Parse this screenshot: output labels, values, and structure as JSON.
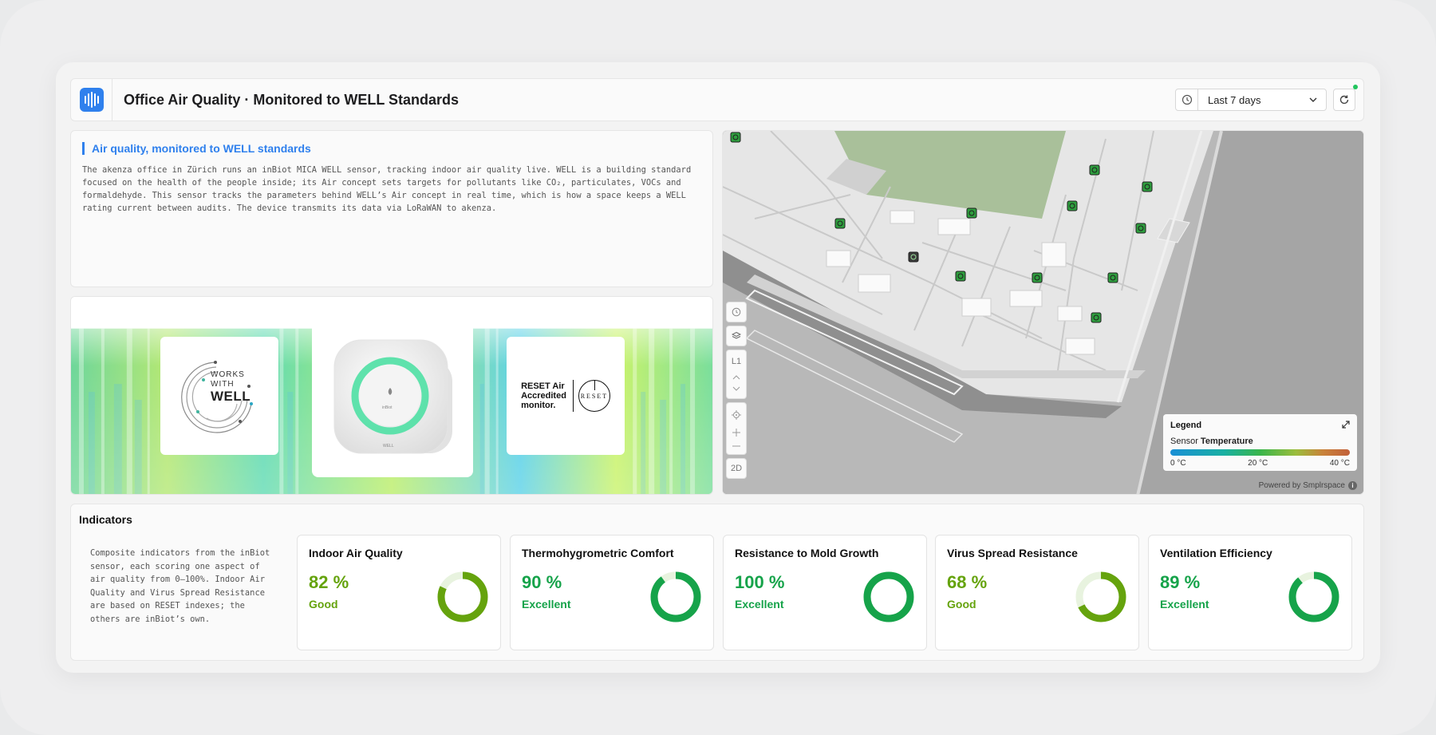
{
  "header": {
    "title": "Office Air Quality · Monitored to WELL Standards",
    "time_range": "Last 7 days"
  },
  "description": {
    "title": "Air quality, monitored to WELL standards",
    "text": "The akenza office in Zürich runs an inBiot MICA WELL sensor, tracking indoor air quality live. WELL is a building standard focused on the health of the people inside; its Air concept sets targets for pollutants like CO₂, particulates, VOCs and formaldehyde. This sensor tracks the parameters behind WELL’s Air concept in real time, which is how a space keeps a WELL rating current between audits. The device transmits its data via LoRaWAN to akenza."
  },
  "images": {
    "well_badge": [
      "WORKS",
      "WITH",
      "WELL"
    ],
    "device_brand": "inBiot",
    "device_label": "WELL",
    "reset_text": [
      "RESET Air",
      "Accredited",
      "monitor."
    ],
    "reset_mark": "RESET"
  },
  "map": {
    "tools": {
      "level": "L1",
      "view_mode": "2D"
    },
    "legend": {
      "title": "Legend",
      "sensor_prefix": "Sensor",
      "sensor_metric": "Temperature",
      "ticks": [
        "0 °C",
        "20 °C",
        "40 °C"
      ],
      "gradient_colors": [
        "#1a8fd6",
        "#19b0a2",
        "#39b54a",
        "#9bbd3c",
        "#c9823a",
        "#c2603a"
      ]
    },
    "powered_by": "Powered by Smplrspace",
    "sensor_marker_color": "#2e9e3e"
  },
  "indicators": {
    "title": "Indicators",
    "text": "Composite indicators from the inBiot sensor, each scoring one aspect of air quality from 0–100%. Indoor Air Quality and Virus Spread Resistance are based on RESET indexes; the others are inBiot’s own.",
    "cards": [
      {
        "name": "Indoor Air Quality",
        "value_text": "82 %",
        "value": 82,
        "status": "Good",
        "color": "#65a30d"
      },
      {
        "name": "Thermohygrometric Comfort",
        "value_text": "90 %",
        "value": 90,
        "status": "Excellent",
        "color": "#16a34a"
      },
      {
        "name": "Resistance to Mold Growth",
        "value_text": "100 %",
        "value": 100,
        "status": "Excellent",
        "color": "#16a34a"
      },
      {
        "name": "Virus Spread Resistance",
        "value_text": "68 %",
        "value": 68,
        "status": "Good",
        "color": "#65a30d"
      },
      {
        "name": "Ventilation Efficiency",
        "value_text": "89 %",
        "value": 89,
        "status": "Excellent",
        "color": "#16a34a"
      }
    ]
  }
}
